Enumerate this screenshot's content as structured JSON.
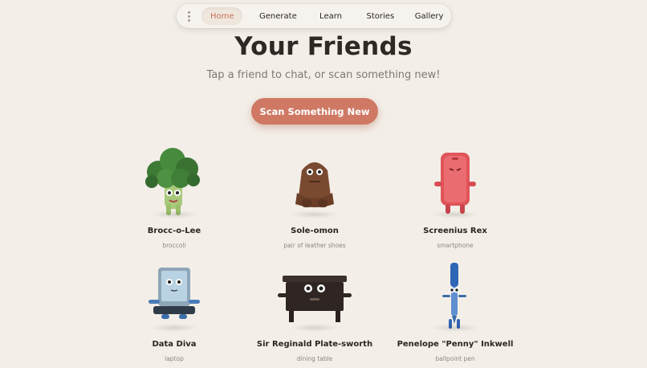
{
  "nav": {
    "tabs": [
      {
        "label": "Home",
        "active": true
      },
      {
        "label": "Generate",
        "active": false
      },
      {
        "label": "Learn",
        "active": false
      },
      {
        "label": "Stories",
        "active": false
      },
      {
        "label": "Gallery",
        "active": false
      }
    ]
  },
  "page": {
    "title": "Your Friends",
    "subtitle": "Tap a friend to chat, or scan something new!",
    "scan_button": "Scan Something New"
  },
  "friends": [
    {
      "name": "Brocc-o-Lee",
      "object": "broccoli",
      "icon": "broccoli-character-icon"
    },
    {
      "name": "Sole-omon",
      "object": "pair of leather shoes",
      "icon": "shoes-character-icon"
    },
    {
      "name": "Screenius Rex",
      "object": "smartphone",
      "icon": "smartphone-character-icon"
    },
    {
      "name": "Data Diva",
      "object": "laptop",
      "icon": "laptop-character-icon"
    },
    {
      "name": "Sir Reginald Plate-sworth",
      "object": "dining table",
      "icon": "table-character-icon"
    },
    {
      "name": "Penelope \"Penny\" Inkwell",
      "object": "ballpoint pen",
      "icon": "pen-character-icon"
    }
  ],
  "colors": {
    "background": "#f3efe8",
    "accent": "#cf7964",
    "active_tab_text": "#c8705c"
  }
}
